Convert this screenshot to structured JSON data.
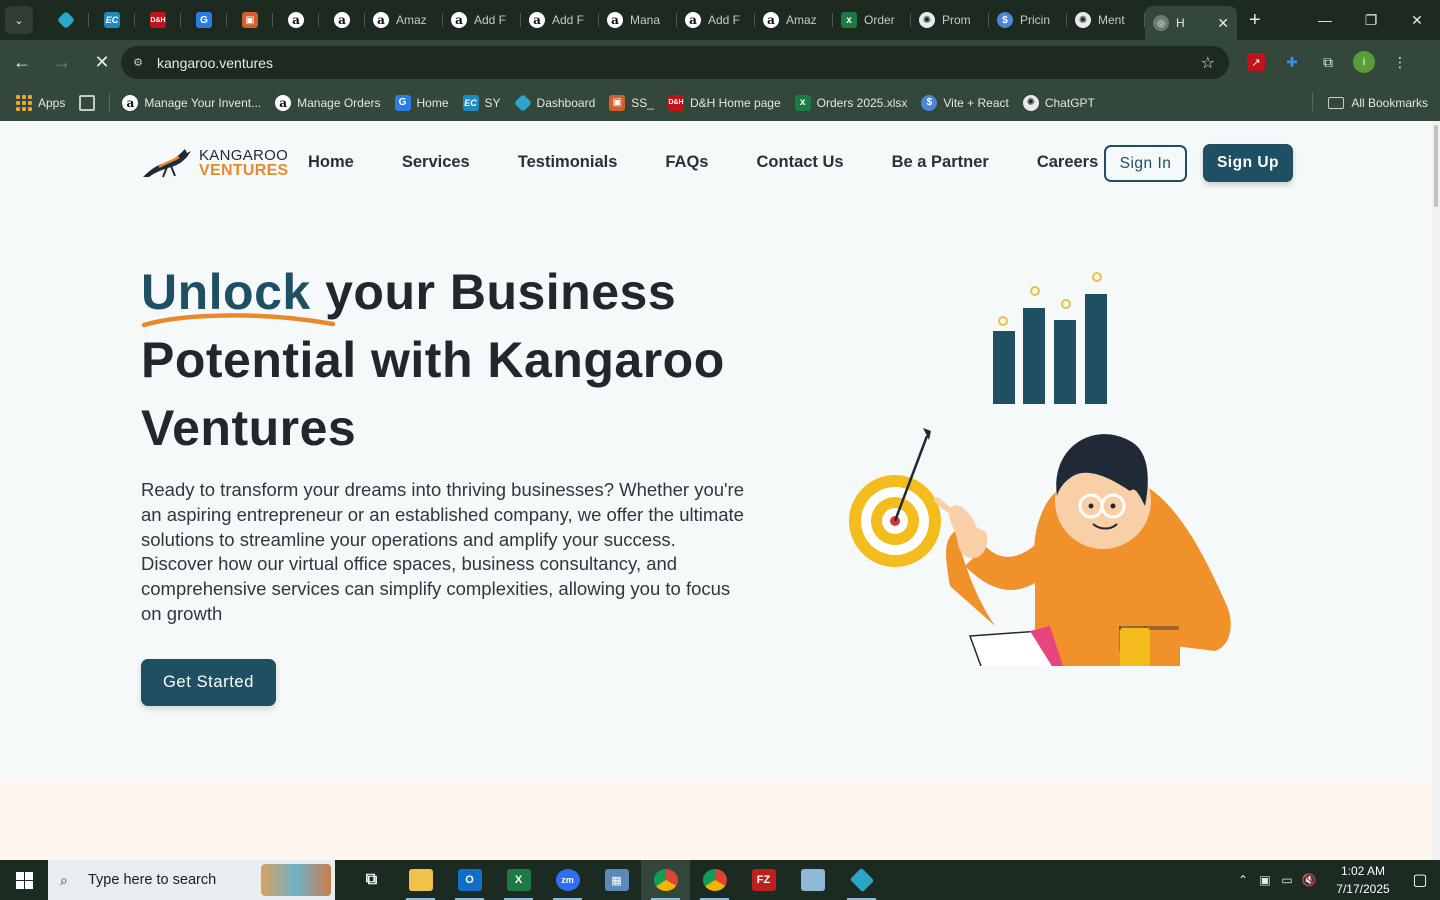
{
  "browser": {
    "tabs": [
      {
        "icon": "diamond-icon",
        "title": "",
        "kind": "fav-diamond"
      },
      {
        "icon": "ec-icon",
        "title": "",
        "kind": "fav-ec",
        "glyph": "EC"
      },
      {
        "icon": "dh-icon",
        "title": "",
        "kind": "fav-dh",
        "glyph": "D&H"
      },
      {
        "icon": "g-icon",
        "title": "",
        "kind": "fav-g",
        "glyph": "G"
      },
      {
        "icon": "box-icon",
        "title": "",
        "kind": "fav-box",
        "glyph": "▣"
      },
      {
        "icon": "amazon-icon",
        "title": "",
        "kind": "fav-amazon",
        "glyph": "a"
      },
      {
        "icon": "amazon-icon",
        "title": "",
        "kind": "fav-amazon",
        "glyph": "a"
      },
      {
        "icon": "amazon-icon",
        "title": "Amaz",
        "kind": "fav-amazon",
        "glyph": "a"
      },
      {
        "icon": "amazon-icon",
        "title": "Add F",
        "kind": "fav-amazon",
        "glyph": "a"
      },
      {
        "icon": "amazon-icon",
        "title": "Add F",
        "kind": "fav-amazon",
        "glyph": "a"
      },
      {
        "icon": "amazon-icon",
        "title": "Mana",
        "kind": "fav-amazon",
        "glyph": "a"
      },
      {
        "icon": "amazon-icon",
        "title": "Add F",
        "kind": "fav-amazon",
        "glyph": "a"
      },
      {
        "icon": "amazon-icon",
        "title": "Amaz",
        "kind": "fav-amazon",
        "glyph": "a"
      },
      {
        "icon": "excel-icon",
        "title": "Order",
        "kind": "fav-excel",
        "glyph": "x"
      },
      {
        "icon": "chatgpt-icon",
        "title": "Prom",
        "kind": "fav-gpt",
        "glyph": "✺"
      },
      {
        "icon": "dollar-icon",
        "title": "Pricin",
        "kind": "fav-dollar",
        "glyph": "$"
      },
      {
        "icon": "chatgpt-icon",
        "title": "Ment",
        "kind": "fav-gpt",
        "glyph": "✺"
      }
    ],
    "active_tab": {
      "title": "H",
      "icon": "kangaroo-icon"
    },
    "url": "kangaroo.ventures",
    "bookmarks": [
      {
        "label": "Apps",
        "icon": "apps-icon"
      },
      {
        "label": "",
        "icon": "grid-icon"
      },
      {
        "label": "Manage Your Invent...",
        "icon": "amazon-icon"
      },
      {
        "label": "Manage Orders",
        "icon": "amazon-icon"
      },
      {
        "label": "Home",
        "icon": "g-icon"
      },
      {
        "label": "SY",
        "icon": "ec-icon"
      },
      {
        "label": "Dashboard",
        "icon": "diamond-icon"
      },
      {
        "label": "SS_",
        "icon": "box-icon"
      },
      {
        "label": "D&H Home page",
        "icon": "dh-icon"
      },
      {
        "label": "Orders 2025.xlsx",
        "icon": "excel-icon"
      },
      {
        "label": "Vite + React",
        "icon": "dollar-icon"
      },
      {
        "label": "ChatGPT",
        "icon": "chatgpt-icon"
      }
    ],
    "all_bookmarks": "All Bookmarks",
    "profile_initial": "i"
  },
  "site": {
    "logo": {
      "line1": "KANGAROO",
      "line2": "VENTURES"
    },
    "nav": [
      "Home",
      "Services",
      "Testimonials",
      "FAQs",
      "Contact Us",
      "Be a Partner",
      "Careers"
    ],
    "sign_in": "Sign In",
    "sign_up": "Sign Up",
    "hero": {
      "title_accent": "Unlock",
      "title_rest": " your Business Potential with Kangaroo Ventures",
      "description": "Ready to transform your dreams into thriving businesses? Whether you're an aspiring entrepreneur or an established company, we offer the ultimate solutions to streamline your operations and amplify your success. Discover how our virtual office spaces, business consultancy, and comprehensive services can simplify complexities, allowing you to focus on growth",
      "cta": "Get Started"
    },
    "colors": {
      "primary": "#1e4f63",
      "accent": "#e88a2a",
      "text": "#23262f"
    }
  },
  "taskbar": {
    "search_placeholder": "Type here to search",
    "time": "1:02 AM",
    "date": "7/17/2025"
  }
}
